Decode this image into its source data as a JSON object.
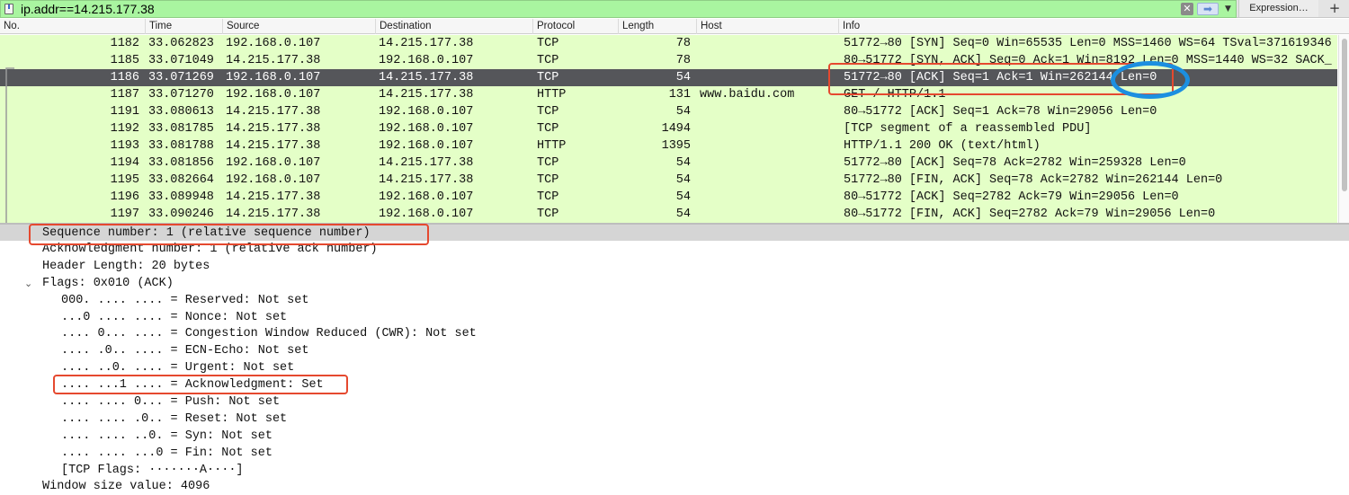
{
  "filter": {
    "value": "ip.addr==14.215.177.38",
    "expression_label": "Expression…",
    "add_label": "+",
    "clear_symbol": "✕",
    "apply_symbol": "➡",
    "dropdown_symbol": "▼"
  },
  "columns": [
    "No.",
    "Time",
    "Source",
    "Destination",
    "Protocol",
    "Length",
    "Host",
    "Info"
  ],
  "packets": [
    {
      "no": "1182",
      "time": "33.062823",
      "src": "192.168.0.107",
      "dst": "14.215.177.38",
      "proto": "TCP",
      "len": "78",
      "host": "",
      "info": "51772→80 [SYN] Seq=0 Win=65535 Len=0 MSS=1460 WS=64 TSval=371619346"
    },
    {
      "no": "1185",
      "time": "33.071049",
      "src": "14.215.177.38",
      "dst": "192.168.0.107",
      "proto": "TCP",
      "len": "78",
      "host": "",
      "info": "80→51772 [SYN, ACK] Seq=0 Ack=1 Win=8192 Len=0 MSS=1440 WS=32 SACK_"
    },
    {
      "no": "1186",
      "time": "33.071269",
      "src": "192.168.0.107",
      "dst": "14.215.177.38",
      "proto": "TCP",
      "len": "54",
      "host": "",
      "info": "51772→80 [ACK] Seq=1 Ack=1 Win=262144 Len=0",
      "selected": true
    },
    {
      "no": "1187",
      "time": "33.071270",
      "src": "192.168.0.107",
      "dst": "14.215.177.38",
      "proto": "HTTP",
      "len": "131",
      "host": "www.baidu.com",
      "info": "GET / HTTP/1.1"
    },
    {
      "no": "1191",
      "time": "33.080613",
      "src": "14.215.177.38",
      "dst": "192.168.0.107",
      "proto": "TCP",
      "len": "54",
      "host": "",
      "info": "80→51772 [ACK] Seq=1 Ack=78 Win=29056 Len=0"
    },
    {
      "no": "1192",
      "time": "33.081785",
      "src": "14.215.177.38",
      "dst": "192.168.0.107",
      "proto": "TCP",
      "len": "1494",
      "host": "",
      "info": "[TCP segment of a reassembled PDU]"
    },
    {
      "no": "1193",
      "time": "33.081788",
      "src": "14.215.177.38",
      "dst": "192.168.0.107",
      "proto": "HTTP",
      "len": "1395",
      "host": "",
      "info": "HTTP/1.1 200 OK  (text/html)"
    },
    {
      "no": "1194",
      "time": "33.081856",
      "src": "192.168.0.107",
      "dst": "14.215.177.38",
      "proto": "TCP",
      "len": "54",
      "host": "",
      "info": "51772→80 [ACK] Seq=78 Ack=2782 Win=259328 Len=0"
    },
    {
      "no": "1195",
      "time": "33.082664",
      "src": "192.168.0.107",
      "dst": "14.215.177.38",
      "proto": "TCP",
      "len": "54",
      "host": "",
      "info": "51772→80 [FIN, ACK] Seq=78 Ack=2782 Win=262144 Len=0"
    },
    {
      "no": "1196",
      "time": "33.089948",
      "src": "14.215.177.38",
      "dst": "192.168.0.107",
      "proto": "TCP",
      "len": "54",
      "host": "",
      "info": "80→51772 [ACK] Seq=2782 Ack=79 Win=29056 Len=0"
    },
    {
      "no": "1197",
      "time": "33.090246",
      "src": "14.215.177.38",
      "dst": "192.168.0.107",
      "proto": "TCP",
      "len": "54",
      "host": "",
      "info": "80→51772 [FIN, ACK] Seq=2782 Ack=79 Win=29056 Len=0"
    }
  ],
  "details": {
    "seq": "Sequence number: 1    (relative sequence number)",
    "ack": "Acknowledgment number: 1    (relative ack number)",
    "header_len": "Header Length: 20 bytes",
    "flags": "Flags: 0x010 (ACK)",
    "flag_lines": [
      "000. .... .... = Reserved: Not set",
      "...0 .... .... = Nonce: Not set",
      ".... 0... .... = Congestion Window Reduced (CWR): Not set",
      ".... .0.. .... = ECN-Echo: Not set",
      ".... ..0. .... = Urgent: Not set",
      ".... ...1 .... = Acknowledgment: Set",
      ".... .... 0... = Push: Not set",
      ".... .... .0.. = Reset: Not set",
      ".... .... ..0. = Syn: Not set",
      ".... .... ...0 = Fin: Not set"
    ],
    "tcp_flags": "[TCP Flags: ·······A····]",
    "window": "Window size value: 4096",
    "chevron": "⌄"
  }
}
